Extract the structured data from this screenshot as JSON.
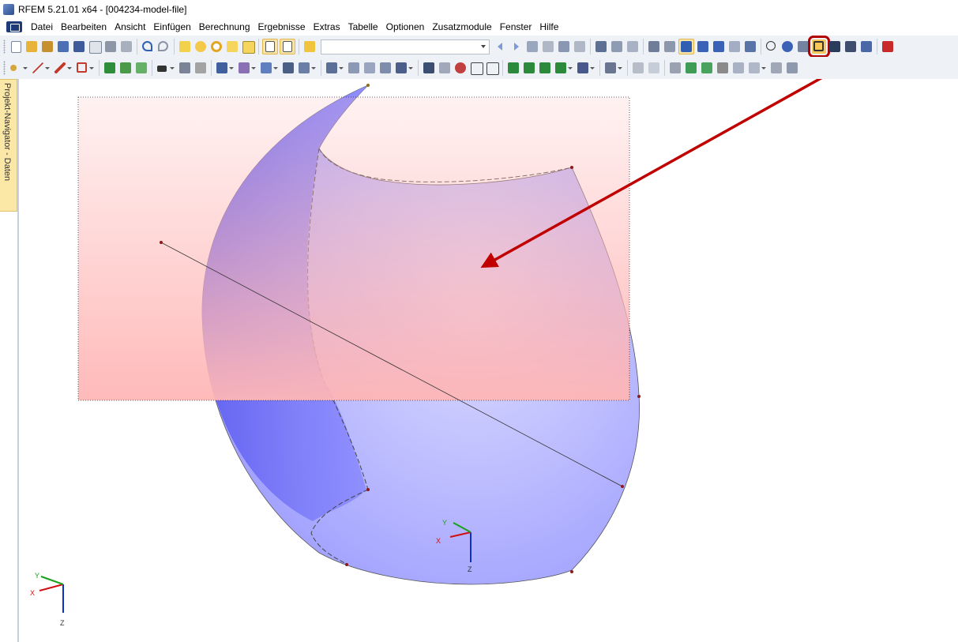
{
  "window": {
    "title": "RFEM 5.21.01 x64 - [004234-model-file]",
    "app_icon": "rfem-app-icon"
  },
  "menubar": {
    "items": [
      "Datei",
      "Bearbeiten",
      "Ansicht",
      "Einfügen",
      "Berechnung",
      "Ergebnisse",
      "Extras",
      "Tabelle",
      "Optionen",
      "Zusatzmodule",
      "Fenster",
      "Hilfe"
    ]
  },
  "toolbar1": {
    "combo_value": "",
    "highlighted_button": "show-surface-axes-button",
    "highlight_color": "#b00000"
  },
  "navigator": {
    "label": "Projekt-Navigator - Daten"
  },
  "viewport": {
    "axes_large": {
      "x": "X",
      "y": "Y",
      "z": "Z"
    },
    "axes_small": {
      "x": "X",
      "y": "Y",
      "z": "Z"
    },
    "colors": {
      "x_axis": "#d01010",
      "y_axis": "#1aa01a",
      "z_axis": "#1030c0",
      "surface": "#8c8cff",
      "selection_rect": "#ffb6b6",
      "arrow": "#c00000"
    }
  }
}
